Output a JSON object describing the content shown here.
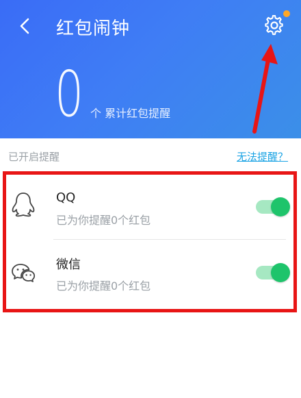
{
  "header": {
    "title": "红包闹钟",
    "count": "0",
    "count_label": "个 累计红包提醒",
    "icons": [
      "chevron-left-icon",
      "gear-icon"
    ],
    "notification_dot_color": "#ffa726",
    "gradient": [
      "#3a6cf6",
      "#3b8fe8"
    ]
  },
  "section": {
    "title": "已开启提醒",
    "help_link": "无法提醒？"
  },
  "items": [
    {
      "name": "QQ",
      "subtitle": "已为你提醒0个红包",
      "icon": "qq-penguin-icon",
      "enabled": true
    },
    {
      "name": "微信",
      "subtitle": "已为你提醒0个红包",
      "icon": "wechat-icon",
      "enabled": true
    }
  ],
  "annotations": {
    "highlight_color": "#e81515",
    "arrow_color": "#e81515"
  },
  "colors": {
    "toggle_on": "#1ec46b",
    "toggle_track": "#a6e8c2",
    "link": "#1aa3e4"
  }
}
